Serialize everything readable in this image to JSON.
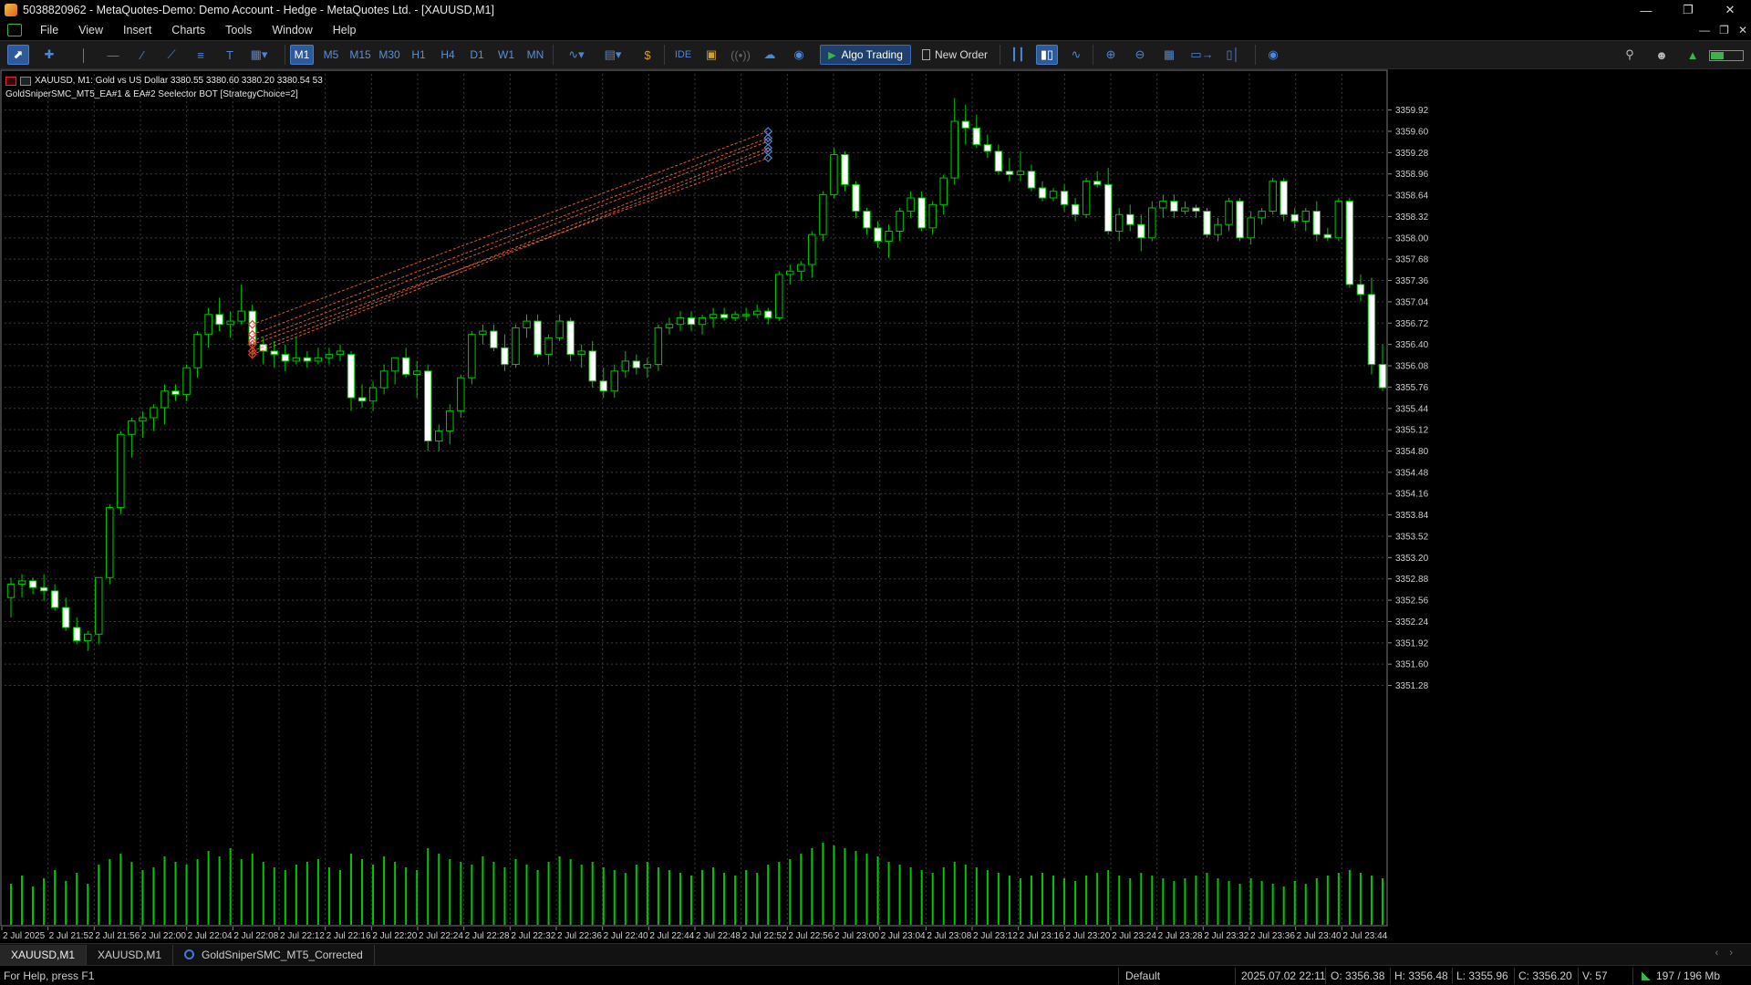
{
  "window": {
    "title": "5038820962 - MetaQuotes-Demo: Demo Account - Hedge - MetaQuotes Ltd. - [XAUUSD,M1]",
    "buttons": [
      "minimize-icon",
      "restore-icon",
      "close-icon"
    ]
  },
  "menu": {
    "items": [
      "File",
      "View",
      "Insert",
      "Charts",
      "Tools",
      "Window",
      "Help"
    ]
  },
  "toolbar": {
    "timeframes": [
      "M1",
      "M5",
      "M15",
      "M30",
      "H1",
      "H4",
      "D1",
      "W1",
      "MN"
    ],
    "active_timeframe": "M1",
    "ide_label": "IDE",
    "algo_trading_label": "Algo Trading",
    "new_order_label": "New Order"
  },
  "chart_info": {
    "symbol_line": "XAUUSD, M1:  Gold vs US Dollar  3380.55 3380.60 3380.20 3380.54  53",
    "ea_line": "GoldSniperSMC_MT5_EA#1 & EA#2 Seelector BOT [StrategyChoice=2]"
  },
  "chart_data": {
    "type": "candlestick",
    "symbol": "XAUUSD",
    "timeframe": "M1",
    "price_labels": [
      "3359.92",
      "3359.60",
      "3359.28",
      "3358.96",
      "3358.64",
      "3358.32",
      "3358.00",
      "3357.68",
      "3357.36",
      "3357.04",
      "3356.72",
      "3356.40",
      "3356.08",
      "3355.76",
      "3355.44",
      "3355.12",
      "3354.80",
      "3354.48",
      "3354.16",
      "3353.84",
      "3353.52",
      "3353.20",
      "3352.88",
      "3352.56",
      "3352.24",
      "3351.92",
      "3351.60",
      "3351.28"
    ],
    "y_range": [
      3351.0,
      3360.12
    ],
    "time_labels": [
      "2 Jul 2025",
      "2 Jul 21:52",
      "2 Jul 21:56",
      "2 Jul 22:00",
      "2 Jul 22:04",
      "2 Jul 22:08",
      "2 Jul 22:12",
      "2 Jul 22:16",
      "2 Jul 22:20",
      "2 Jul 22:24",
      "2 Jul 22:28",
      "2 Jul 22:32",
      "2 Jul 22:36",
      "2 Jul 22:40",
      "2 Jul 22:44",
      "2 Jul 22:48",
      "2 Jul 22:52",
      "2 Jul 22:56",
      "2 Jul 23:00",
      "2 Jul 23:04",
      "2 Jul 23:08",
      "2 Jul 23:12",
      "2 Jul 23:16",
      "2 Jul 23:20",
      "2 Jul 23:24",
      "2 Jul 23:28",
      "2 Jul 23:32",
      "2 Jul 23:36",
      "2 Jul 23:40",
      "2 Jul 23:44"
    ],
    "ohlc": [
      [
        3352.6,
        3352.9,
        3352.3,
        3352.8
      ],
      [
        3352.8,
        3352.95,
        3352.6,
        3352.85
      ],
      [
        3352.85,
        3352.9,
        3352.65,
        3352.75
      ],
      [
        3352.75,
        3352.95,
        3352.55,
        3352.7
      ],
      [
        3352.7,
        3352.8,
        3352.4,
        3352.45
      ],
      [
        3352.45,
        3352.6,
        3352.1,
        3352.15
      ],
      [
        3352.15,
        3352.3,
        3351.9,
        3351.95
      ],
      [
        3351.95,
        3352.1,
        3351.8,
        3352.05
      ],
      [
        3352.05,
        3352.9,
        3351.9,
        3352.9
      ],
      [
        3352.9,
        3354.0,
        3352.8,
        3353.95
      ],
      [
        3353.95,
        3355.1,
        3353.85,
        3355.05
      ],
      [
        3355.05,
        3355.3,
        3354.7,
        3355.25
      ],
      [
        3355.25,
        3355.4,
        3355.0,
        3355.3
      ],
      [
        3355.3,
        3355.5,
        3355.1,
        3355.45
      ],
      [
        3355.45,
        3355.8,
        3355.2,
        3355.7
      ],
      [
        3355.7,
        3355.8,
        3355.55,
        3355.65
      ],
      [
        3355.65,
        3356.1,
        3355.55,
        3356.05
      ],
      [
        3356.05,
        3356.6,
        3355.9,
        3356.55
      ],
      [
        3356.55,
        3356.95,
        3356.35,
        3356.85
      ],
      [
        3356.85,
        3357.1,
        3356.6,
        3356.7
      ],
      [
        3356.7,
        3356.9,
        3356.5,
        3356.75
      ],
      [
        3356.75,
        3357.3,
        3356.7,
        3356.9
      ],
      [
        3356.9,
        3357.0,
        3356.2,
        3356.4
      ],
      [
        3356.4,
        3356.5,
        3356.1,
        3356.3
      ],
      [
        3356.3,
        3356.45,
        3356.05,
        3356.25
      ],
      [
        3356.25,
        3356.4,
        3356.0,
        3356.15
      ],
      [
        3356.15,
        3356.5,
        3356.1,
        3356.2
      ],
      [
        3356.2,
        3356.3,
        3356.05,
        3356.15
      ],
      [
        3356.15,
        3356.35,
        3356.1,
        3356.2
      ],
      [
        3356.2,
        3356.35,
        3356.1,
        3356.25
      ],
      [
        3356.25,
        3356.4,
        3356.15,
        3356.3
      ],
      [
        3356.25,
        3356.3,
        3355.4,
        3355.6
      ],
      [
        3355.6,
        3355.8,
        3355.45,
        3355.55
      ],
      [
        3355.55,
        3355.85,
        3355.4,
        3355.75
      ],
      [
        3355.75,
        3356.1,
        3355.65,
        3356.0
      ],
      [
        3356.0,
        3356.2,
        3355.8,
        3356.2
      ],
      [
        3356.2,
        3356.35,
        3355.9,
        3355.95
      ],
      [
        3355.95,
        3356.15,
        3355.6,
        3356.0
      ],
      [
        3356.0,
        3356.1,
        3354.8,
        3354.95
      ],
      [
        3354.95,
        3355.2,
        3354.8,
        3355.1
      ],
      [
        3355.1,
        3355.5,
        3354.9,
        3355.4
      ],
      [
        3355.4,
        3355.95,
        3355.3,
        3355.9
      ],
      [
        3355.9,
        3356.6,
        3355.8,
        3356.55
      ],
      [
        3356.55,
        3356.7,
        3356.4,
        3356.6
      ],
      [
        3356.6,
        3356.7,
        3356.3,
        3356.35
      ],
      [
        3356.35,
        3356.55,
        3356.0,
        3356.1
      ],
      [
        3356.1,
        3356.7,
        3356.05,
        3356.65
      ],
      [
        3356.65,
        3356.85,
        3356.5,
        3356.75
      ],
      [
        3356.75,
        3356.85,
        3356.2,
        3356.25
      ],
      [
        3356.25,
        3356.55,
        3356.1,
        3356.5
      ],
      [
        3356.5,
        3356.85,
        3356.45,
        3356.75
      ],
      [
        3356.75,
        3356.8,
        3356.15,
        3356.25
      ],
      [
        3356.25,
        3356.4,
        3356.05,
        3356.3
      ],
      [
        3356.3,
        3356.45,
        3355.75,
        3355.85
      ],
      [
        3355.85,
        3356.05,
        3355.6,
        3355.7
      ],
      [
        3355.7,
        3356.1,
        3355.6,
        3356.0
      ],
      [
        3356.0,
        3356.3,
        3355.9,
        3356.15
      ],
      [
        3356.15,
        3356.25,
        3355.95,
        3356.05
      ],
      [
        3356.05,
        3356.2,
        3355.9,
        3356.1
      ],
      [
        3356.1,
        3356.7,
        3356.0,
        3356.65
      ],
      [
        3356.65,
        3356.8,
        3356.55,
        3356.7
      ],
      [
        3356.7,
        3356.9,
        3356.6,
        3356.8
      ],
      [
        3356.8,
        3356.9,
        3356.6,
        3356.7
      ],
      [
        3356.7,
        3356.85,
        3356.55,
        3356.8
      ],
      [
        3356.8,
        3356.95,
        3356.65,
        3356.85
      ],
      [
        3356.85,
        3356.95,
        3356.75,
        3356.8
      ],
      [
        3356.8,
        3356.9,
        3356.75,
        3356.85
      ],
      [
        3356.85,
        3356.95,
        3356.75,
        3356.85
      ],
      [
        3356.85,
        3357.0,
        3356.8,
        3356.9
      ],
      [
        3356.9,
        3356.95,
        3356.7,
        3356.8
      ],
      [
        3356.8,
        3357.5,
        3356.75,
        3357.45
      ],
      [
        3357.45,
        3357.6,
        3357.3,
        3357.5
      ],
      [
        3357.5,
        3357.65,
        3357.35,
        3357.6
      ],
      [
        3357.6,
        3358.1,
        3357.4,
        3358.05
      ],
      [
        3358.05,
        3358.7,
        3357.95,
        3358.65
      ],
      [
        3358.65,
        3359.35,
        3358.6,
        3359.25
      ],
      [
        3359.25,
        3359.3,
        3358.7,
        3358.8
      ],
      [
        3358.8,
        3358.85,
        3358.3,
        3358.4
      ],
      [
        3358.4,
        3358.45,
        3358.05,
        3358.15
      ],
      [
        3358.15,
        3358.25,
        3357.85,
        3357.95
      ],
      [
        3357.95,
        3358.2,
        3357.7,
        3358.1
      ],
      [
        3358.1,
        3358.45,
        3357.95,
        3358.4
      ],
      [
        3358.4,
        3358.7,
        3358.3,
        3358.6
      ],
      [
        3358.6,
        3358.7,
        3358.1,
        3358.15
      ],
      [
        3358.15,
        3358.55,
        3358.05,
        3358.5
      ],
      [
        3358.5,
        3358.95,
        3358.35,
        3358.9
      ],
      [
        3358.9,
        3360.1,
        3358.8,
        3359.75
      ],
      [
        3359.75,
        3360.0,
        3359.4,
        3359.65
      ],
      [
        3359.65,
        3359.85,
        3359.35,
        3359.4
      ],
      [
        3359.4,
        3359.55,
        3359.2,
        3359.3
      ],
      [
        3359.3,
        3359.4,
        3358.95,
        3359.0
      ],
      [
        3359.0,
        3359.2,
        3358.85,
        3358.95
      ],
      [
        3358.95,
        3359.3,
        3358.85,
        3359.0
      ],
      [
        3359.0,
        3359.1,
        3358.7,
        3358.75
      ],
      [
        3358.75,
        3358.85,
        3358.55,
        3358.6
      ],
      [
        3358.6,
        3358.75,
        3358.55,
        3358.7
      ],
      [
        3358.7,
        3358.8,
        3358.4,
        3358.5
      ],
      [
        3358.5,
        3358.6,
        3358.25,
        3358.35
      ],
      [
        3358.35,
        3358.9,
        3358.3,
        3358.85
      ],
      [
        3358.85,
        3359.0,
        3358.75,
        3358.8
      ],
      [
        3358.8,
        3359.05,
        3358.05,
        3358.1
      ],
      [
        3358.1,
        3358.45,
        3357.95,
        3358.35
      ],
      [
        3358.35,
        3358.5,
        3358.1,
        3358.2
      ],
      [
        3358.2,
        3358.35,
        3357.8,
        3358.0
      ],
      [
        3358.0,
        3358.55,
        3357.95,
        3358.45
      ],
      [
        3358.45,
        3358.65,
        3358.3,
        3358.55
      ],
      [
        3358.55,
        3358.65,
        3358.3,
        3358.4
      ],
      [
        3358.4,
        3358.55,
        3358.35,
        3358.45
      ],
      [
        3358.45,
        3358.5,
        3358.3,
        3358.4
      ],
      [
        3358.4,
        3358.45,
        3358.0,
        3358.05
      ],
      [
        3358.05,
        3358.3,
        3357.95,
        3358.2
      ],
      [
        3358.2,
        3358.6,
        3358.1,
        3358.55
      ],
      [
        3358.55,
        3358.6,
        3357.95,
        3358.0
      ],
      [
        3358.0,
        3358.4,
        3357.9,
        3358.3
      ],
      [
        3358.3,
        3358.45,
        3358.2,
        3358.4
      ],
      [
        3358.4,
        3358.9,
        3358.35,
        3358.85
      ],
      [
        3358.85,
        3358.9,
        3358.25,
        3358.35
      ],
      [
        3358.35,
        3358.45,
        3358.15,
        3358.25
      ],
      [
        3358.25,
        3358.45,
        3358.1,
        3358.4
      ],
      [
        3358.4,
        3358.55,
        3357.95,
        3358.05
      ],
      [
        3358.05,
        3358.15,
        3357.95,
        3358.0
      ],
      [
        3358.0,
        3358.6,
        3357.95,
        3358.55
      ],
      [
        3358.55,
        3358.6,
        3357.25,
        3357.3
      ],
      [
        3357.3,
        3357.45,
        3357.05,
        3357.15
      ],
      [
        3357.15,
        3357.4,
        3355.95,
        3356.1
      ],
      [
        3356.1,
        3356.4,
        3355.7,
        3355.75
      ]
    ],
    "volume": [
      30,
      36,
      28,
      34,
      40,
      32,
      38,
      30,
      44,
      48,
      52,
      46,
      40,
      42,
      50,
      46,
      44,
      48,
      54,
      50,
      56,
      48,
      52,
      46,
      42,
      40,
      44,
      46,
      48,
      42,
      40,
      52,
      48,
      44,
      50,
      46,
      42,
      40,
      56,
      52,
      48,
      46,
      44,
      50,
      46,
      42,
      48,
      44,
      40,
      46,
      50,
      48,
      44,
      46,
      42,
      40,
      38,
      44,
      46,
      42,
      40,
      38,
      36,
      40,
      42,
      38,
      36,
      40,
      38,
      44,
      46,
      48,
      52,
      56,
      60,
      58,
      56,
      54,
      52,
      50,
      46,
      44,
      42,
      40,
      38,
      42,
      46,
      44,
      42,
      40,
      38,
      36,
      34,
      36,
      38,
      36,
      34,
      32,
      36,
      38,
      40,
      36,
      34,
      38,
      36,
      34,
      32,
      34,
      36,
      38,
      34,
      32,
      30,
      34,
      32,
      30,
      28,
      32,
      30,
      34,
      36,
      38,
      40,
      38,
      36,
      34
    ],
    "trade_lines": {
      "from_bar": 22,
      "to_bar": 69,
      "from_prices": [
        3356.4,
        3356.25,
        3356.3,
        3356.45,
        3356.55,
        3356.7
      ],
      "to_prices": [
        3359.2,
        3359.3,
        3359.35,
        3359.45,
        3359.5,
        3359.6
      ]
    },
    "colors": {
      "background": "#000000",
      "grid": "#3a3a3a",
      "bull_body": "#000000",
      "bear_body": "#ffffff",
      "wick": "#00c800",
      "volume": "#00c800",
      "trade_line": "#ff6a3c",
      "entry_marker": "#ff3030",
      "exit_marker": "#4c86d6"
    },
    "grid": true,
    "legend": "none"
  },
  "tabs": {
    "items": [
      "XAUUSD,M1",
      "XAUUSD,M1",
      "GoldSniperSMC_MT5_Corrected"
    ],
    "active_index": 0
  },
  "status": {
    "help": "For Help, press F1",
    "profile": "Default",
    "datetime": "2025.07.02 22:11",
    "open": "O: 3356.38",
    "high": "H: 3356.48",
    "low": "L: 3355.96",
    "close": "C: 3356.20",
    "volume": "V: 57",
    "traffic": "197 / 196 Mb"
  }
}
